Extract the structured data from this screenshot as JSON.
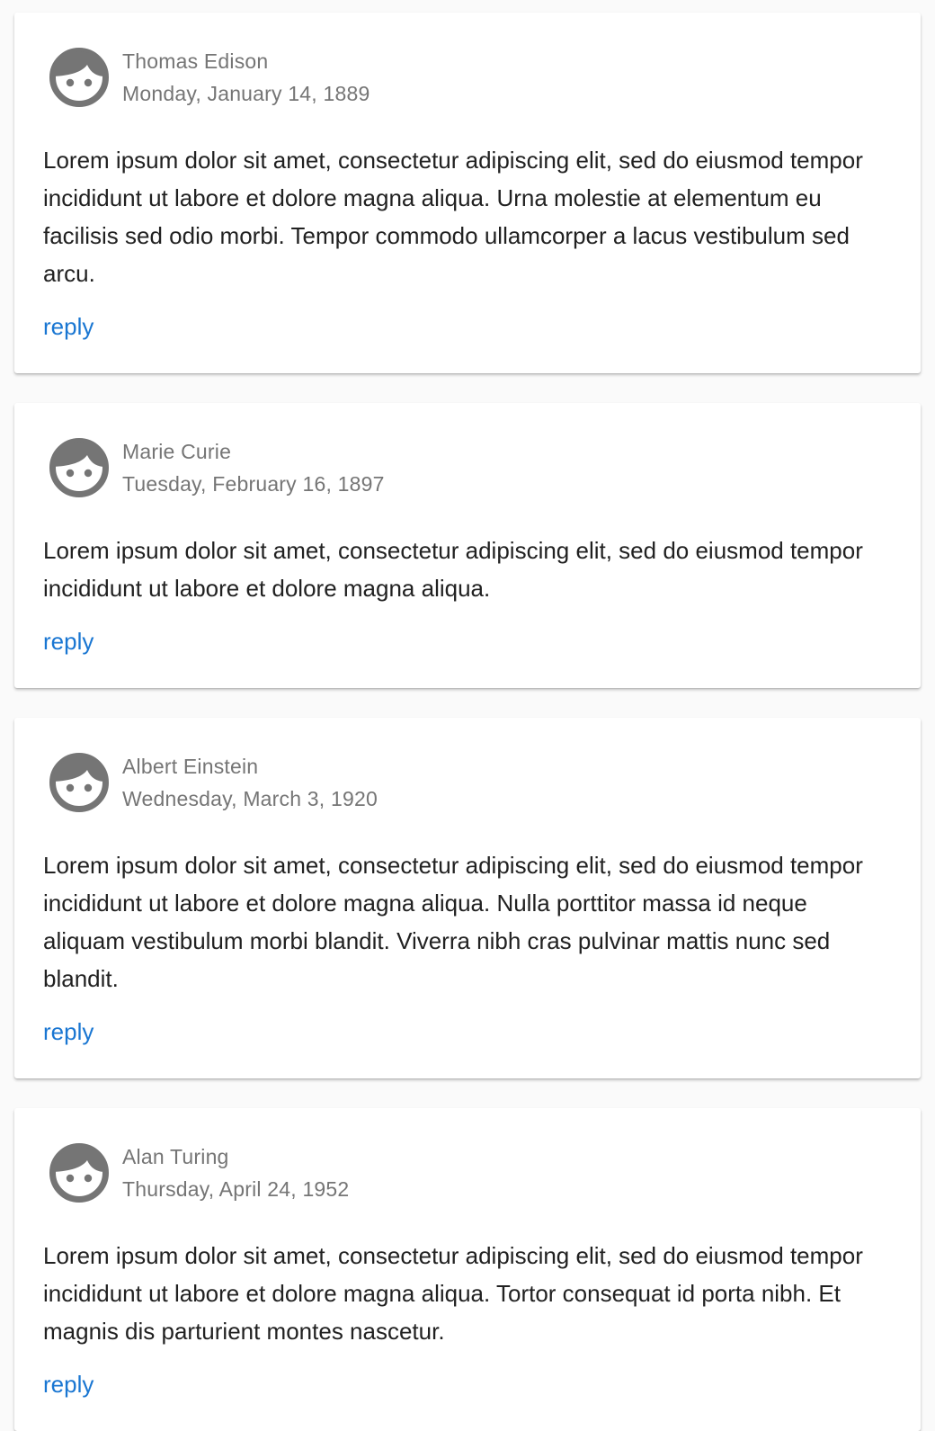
{
  "colors": {
    "background": "#fafafa",
    "card": "#ffffff",
    "meta_text": "#757575",
    "body_text": "#212121",
    "link": "#1976d2",
    "avatar": "#757575"
  },
  "comments": [
    {
      "avatar_icon": "face-icon",
      "author": "Thomas Edison",
      "date": "Monday, January 14, 1889",
      "text": "Lorem ipsum dolor sit amet, consectetur adipiscing elit, sed do eiusmod tempor incididunt ut labore et dolore magna aliqua. Urna molestie at elementum eu facilisis sed odio morbi. Tempor commodo ullamcorper a lacus vestibulum sed arcu.",
      "reply_label": "reply"
    },
    {
      "avatar_icon": "face-icon",
      "author": "Marie Curie",
      "date": "Tuesday, February 16, 1897",
      "text": "Lorem ipsum dolor sit amet, consectetur adipiscing elit, sed do eiusmod tempor incididunt ut labore et dolore magna aliqua.",
      "reply_label": "reply"
    },
    {
      "avatar_icon": "face-icon",
      "author": "Albert Einstein",
      "date": "Wednesday, March 3, 1920",
      "text": "Lorem ipsum dolor sit amet, consectetur adipiscing elit, sed do eiusmod tempor incididunt ut labore et dolore magna aliqua. Nulla porttitor massa id neque aliquam vestibulum morbi blandit. Viverra nibh cras pulvinar mattis nunc sed blandit.",
      "reply_label": "reply"
    },
    {
      "avatar_icon": "face-icon",
      "author": "Alan Turing",
      "date": "Thursday, April 24, 1952",
      "text": "Lorem ipsum dolor sit amet, consectetur adipiscing elit, sed do eiusmod tempor incididunt ut labore et dolore magna aliqua. Tortor consequat id porta nibh. Et magnis dis parturient montes nascetur.",
      "reply_label": "reply"
    }
  ]
}
